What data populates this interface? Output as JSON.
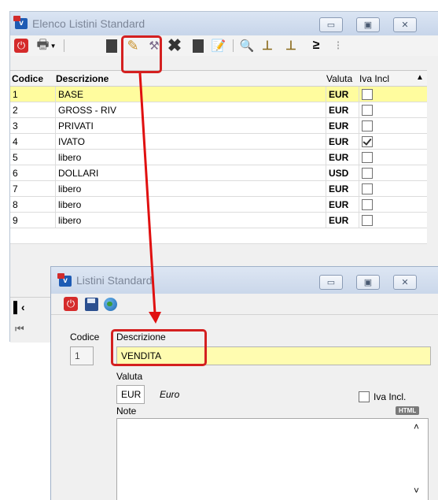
{
  "list_window": {
    "title": "Elenco Listini Standard",
    "toolbar": {
      "icons": [
        "power-icon",
        "print-icon",
        "new-icon",
        "edit-icon",
        "wand-icon",
        "delete-icon",
        "copy-icon",
        "note-icon",
        "preview-icon",
        "chart-icon",
        "compare-icon"
      ]
    },
    "columns": {
      "code": "Codice",
      "description": "Descrizione",
      "currency": "Valuta",
      "iva": "Iva Incl"
    },
    "rows": [
      {
        "code": "1",
        "description": "BASE",
        "currency": "EUR",
        "iva": false,
        "selected": true
      },
      {
        "code": "2",
        "description": "GROSS - RIV",
        "currency": "EUR",
        "iva": false
      },
      {
        "code": "3",
        "description": "PRIVATI",
        "currency": "EUR",
        "iva": false
      },
      {
        "code": "4",
        "description": "IVATO",
        "currency": "EUR",
        "iva": true
      },
      {
        "code": "5",
        "description": "libero",
        "currency": "EUR",
        "iva": false
      },
      {
        "code": "6",
        "description": "DOLLARI",
        "currency": "USD",
        "iva": false
      },
      {
        "code": "7",
        "description": "libero",
        "currency": "EUR",
        "iva": false
      },
      {
        "code": "8",
        "description": "libero",
        "currency": "EUR",
        "iva": false
      },
      {
        "code": "9",
        "description": "libero",
        "currency": "EUR",
        "iva": false
      }
    ]
  },
  "detail_window": {
    "title": "Listini Standard",
    "labels": {
      "code": "Codice",
      "description": "Descrizione",
      "currency": "Valuta",
      "iva": "Iva Incl.",
      "notes": "Note",
      "html_badge": "HTML"
    },
    "values": {
      "code": "1",
      "description": "VENDITA",
      "currency": "EUR",
      "currency_name": "Euro",
      "iva": false,
      "notes": ""
    }
  },
  "colors": {
    "highlight": "#d42020",
    "selected_row": "#fffc9e",
    "description_field": "#fffcb0"
  }
}
